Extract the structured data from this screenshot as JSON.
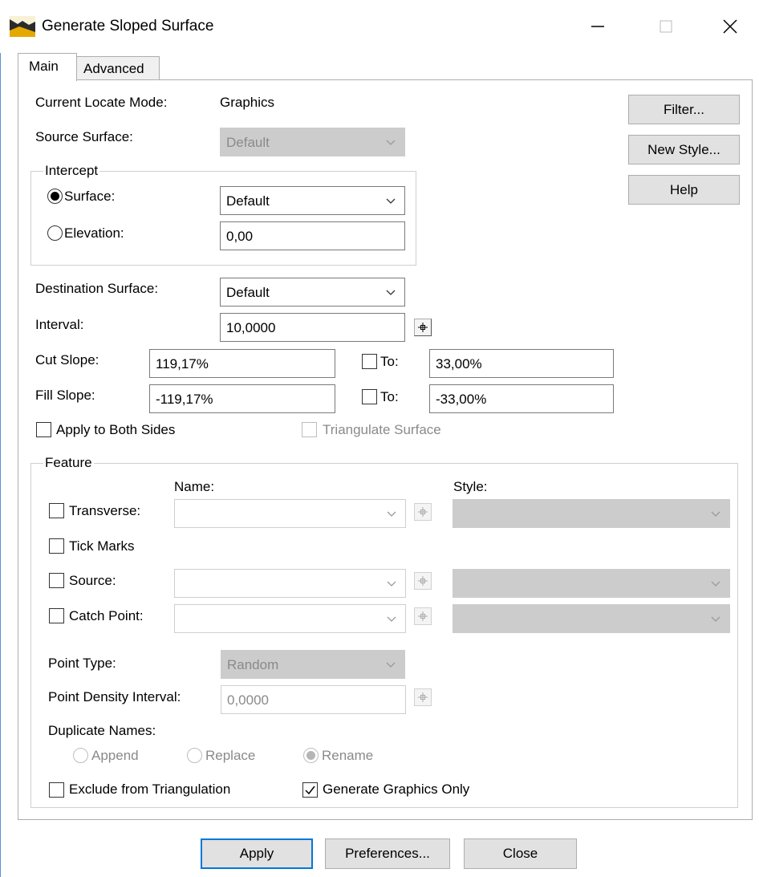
{
  "window": {
    "title": "Generate Sloped Surface"
  },
  "tabs": {
    "main": "Main",
    "advanced": "Advanced"
  },
  "side_buttons": {
    "filter": "Filter...",
    "new_style": "New Style...",
    "help": "Help"
  },
  "locate": {
    "label": "Current Locate Mode:",
    "value": "Graphics"
  },
  "source_surface": {
    "label": "Source Surface:",
    "value": "Default"
  },
  "intercept": {
    "legend": "Intercept",
    "surface_label": "Surface:",
    "surface_value": "Default",
    "elevation_label": "Elevation:",
    "elevation_value": "0,00"
  },
  "destination": {
    "label": "Destination Surface:",
    "value": "Default"
  },
  "interval": {
    "label": "Interval:",
    "value": "10,0000"
  },
  "cut_slope": {
    "label": "Cut Slope:",
    "value": "119,17%",
    "to_label": "To:",
    "to_value": "33,00%"
  },
  "fill_slope": {
    "label": "Fill Slope:",
    "value": "-119,17%",
    "to_label": "To:",
    "to_value": "-33,00%"
  },
  "apply_both_sides": "Apply to Both Sides",
  "triangulate_surface": "Triangulate Surface",
  "feature": {
    "legend": "Feature",
    "name_header": "Name:",
    "style_header": "Style:",
    "transverse": "Transverse:",
    "tick_marks": "Tick Marks",
    "source": "Source:",
    "catch_point": "Catch Point:",
    "point_type_label": "Point Type:",
    "point_type_value": "Random",
    "density_label": "Point Density Interval:",
    "density_value": "0,0000",
    "duplicate_label": "Duplicate Names:",
    "append": "Append",
    "replace": "Replace",
    "rename": "Rename",
    "exclude": "Exclude from Triangulation",
    "graphics_only": "Generate Graphics Only"
  },
  "bottom_buttons": {
    "apply": "Apply",
    "preferences": "Preferences...",
    "close": "Close"
  },
  "colors": {
    "focus_border": "#0078d7",
    "disabled_fill": "#cccccc",
    "button_face": "#e1e1e1"
  }
}
